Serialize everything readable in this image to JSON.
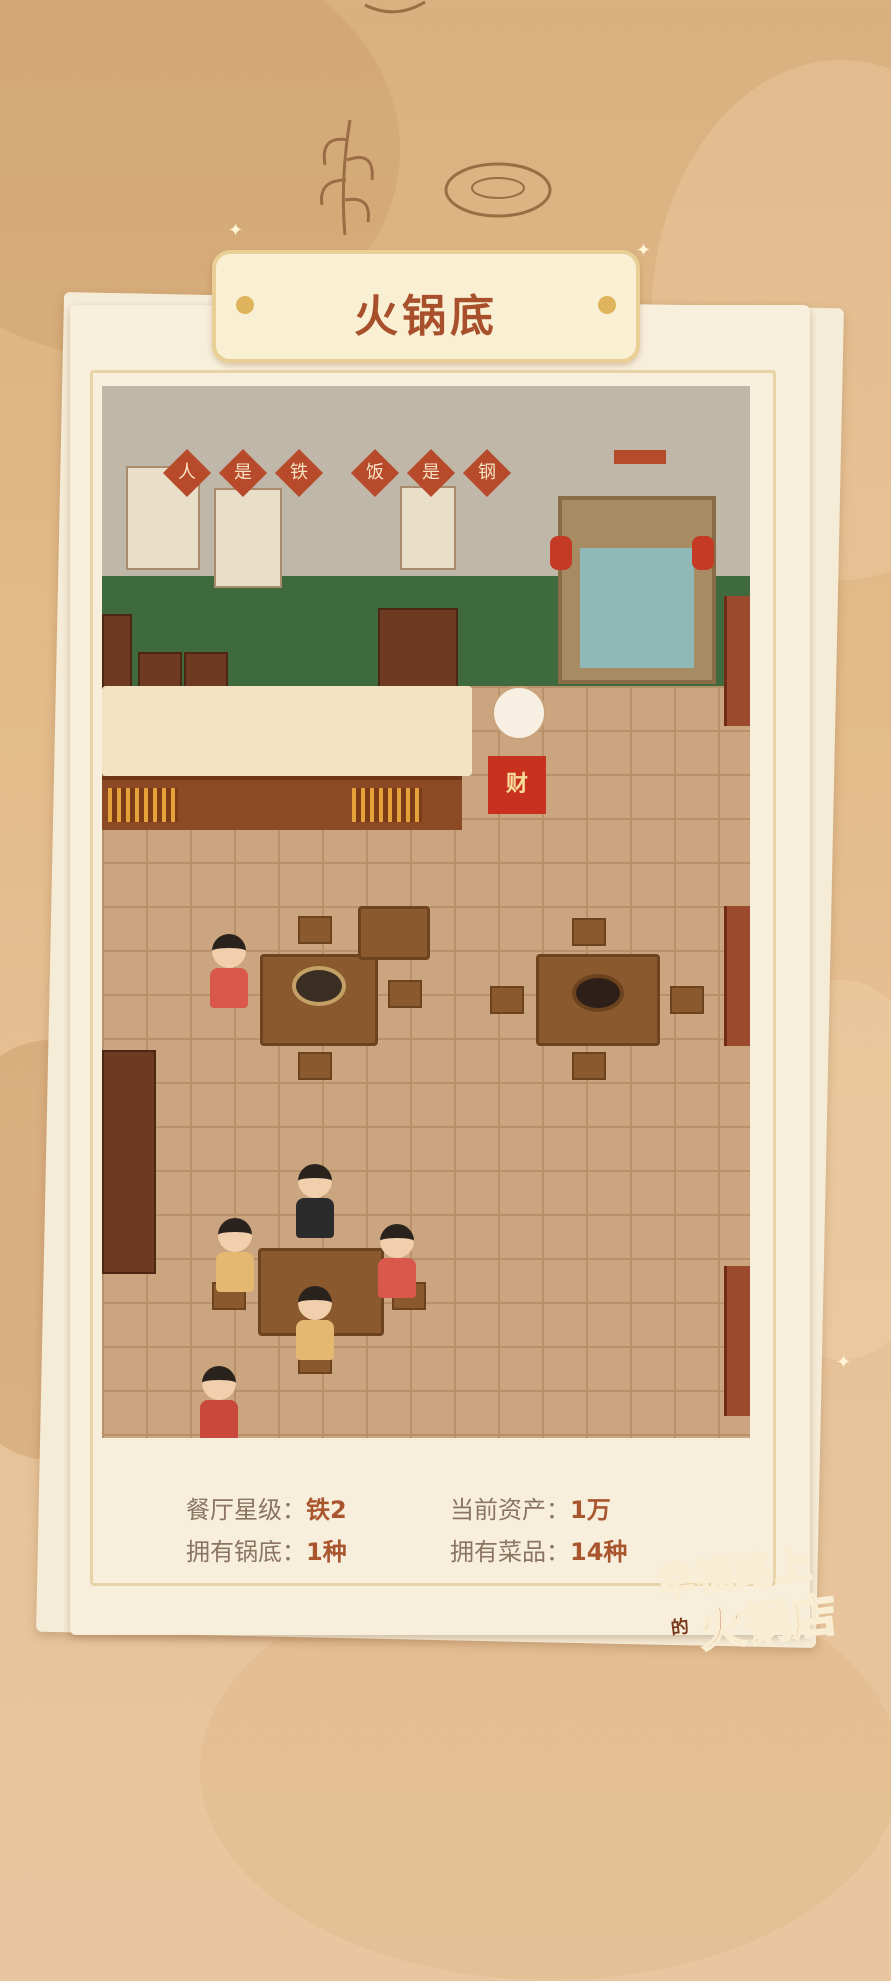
{
  "title": "火锅底",
  "wall_slogan": [
    "人",
    "是",
    "铁",
    "饭",
    "是",
    "钢"
  ],
  "cashier_sign": "财",
  "stats": {
    "star_level_label": "餐厅星级",
    "star_level_value": "铁2",
    "assets_label": "当前资产",
    "assets_value": "1万",
    "pots_label": "拥有锅底",
    "pots_value": "1种",
    "dishes_label": "拥有菜品",
    "dishes_value": "14种",
    "separator": "："
  },
  "logo": {
    "line1": "幸福路上",
    "particle": "的",
    "line2": "火锅店"
  },
  "colors": {
    "title_text": "#a8502b",
    "value_text": "#a9562f",
    "label_text": "#8b7461",
    "background": "#e3bb8a"
  }
}
